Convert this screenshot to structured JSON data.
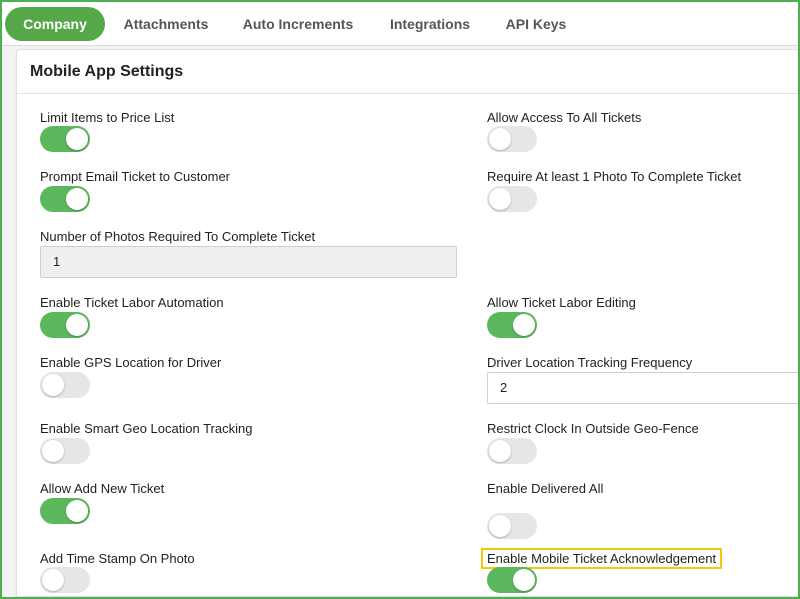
{
  "tabs": [
    {
      "label": "Company",
      "active": true
    },
    {
      "label": "Attachments",
      "active": false
    },
    {
      "label": "Auto Increments",
      "active": false
    },
    {
      "label": "Integrations",
      "active": false
    },
    {
      "label": "API Keys",
      "active": false
    }
  ],
  "panel": {
    "title": "Mobile App Settings"
  },
  "settings": {
    "limit_items": {
      "label": "Limit Items to Price List",
      "on": true
    },
    "allow_access_all_tickets": {
      "label": "Allow Access To All Tickets",
      "on": false
    },
    "prompt_email": {
      "label": "Prompt Email Ticket to Customer",
      "on": true
    },
    "require_photo": {
      "label": "Require At least 1 Photo To Complete Ticket",
      "on": false
    },
    "photos_required": {
      "label": "Number of Photos Required To Complete Ticket",
      "value": "1"
    },
    "labor_automation": {
      "label": "Enable Ticket Labor Automation",
      "on": true
    },
    "labor_editing": {
      "label": "Allow Ticket Labor Editing",
      "on": true
    },
    "gps_location": {
      "label": "Enable GPS Location for Driver",
      "on": false
    },
    "tracking_frequency": {
      "label": "Driver Location Tracking Frequency",
      "value": "2"
    },
    "smart_geo": {
      "label": "Enable Smart Geo Location Tracking",
      "on": false
    },
    "restrict_clock": {
      "label": "Restrict Clock In Outside Geo-Fence",
      "on": false
    },
    "allow_add_ticket": {
      "label": "Allow Add New Ticket",
      "on": true
    },
    "delivered_all": {
      "label": "Enable Delivered All",
      "on": false
    },
    "time_stamp": {
      "label": "Add Time Stamp On Photo",
      "on": false
    },
    "ticket_ack": {
      "label": "Enable Mobile Ticket Acknowledgement",
      "on": true
    }
  },
  "colors": {
    "accent": "#55a747",
    "toggle_on": "#5cb85c",
    "toggle_off": "#e6e6e6",
    "highlight": "#f2c811"
  }
}
